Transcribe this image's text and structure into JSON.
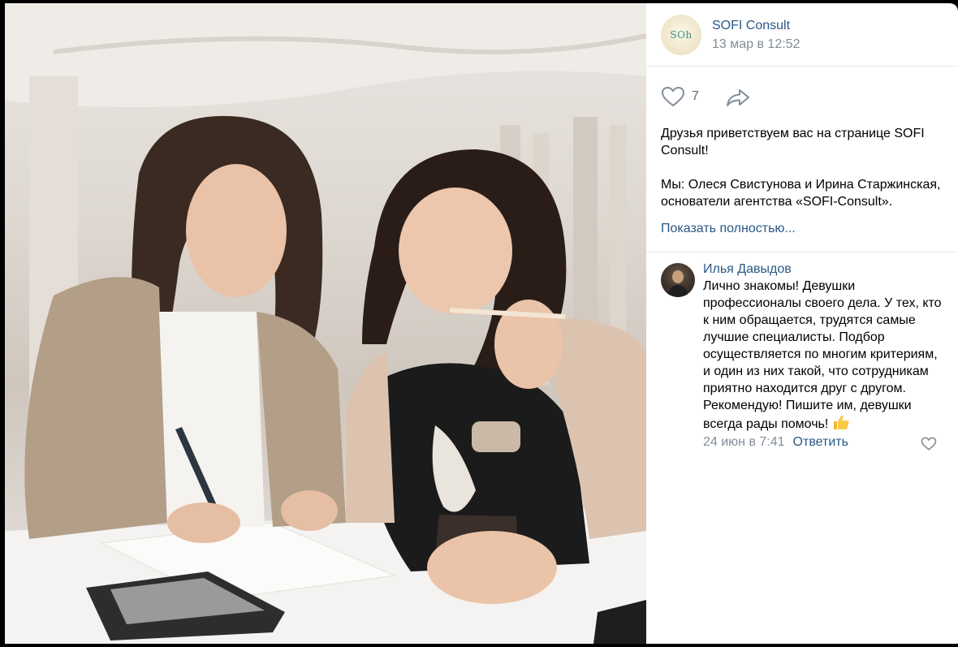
{
  "post": {
    "author": "SOFI Consult",
    "avatar_logo_text": "SOh",
    "date": "13 мар в 12:52",
    "likes": "7",
    "text": "Друзья приветствуем вас на странице SOFI Consult!\n\nМы: Олеся Свистунова и Ирина Старжинская,\nоснователи агентства «SOFI-Consult».",
    "show_more": "Показать полностью..."
  },
  "comment": {
    "author": "Илья Давыдов",
    "text": "Лично знакомы! Девушки профессионалы своего дела. У тех, кто к ним обращается, трудятся самые лучшие специалисты. Подбор осуществляется по многим критериям, и один из них такой, что сотрудникам приятно находится друг с другом. Рекомендую! Пишите им, девушки всегда рады помочь!",
    "date": "24 июн в 7:41",
    "reply": "Ответить"
  },
  "icons": {
    "like": "heart-icon",
    "share": "share-arrow-icon",
    "emoji": "thumbs-up-icon"
  },
  "colors": {
    "link": "#2a5885",
    "secondary": "#818c99",
    "divider": "#e7e8ec"
  }
}
